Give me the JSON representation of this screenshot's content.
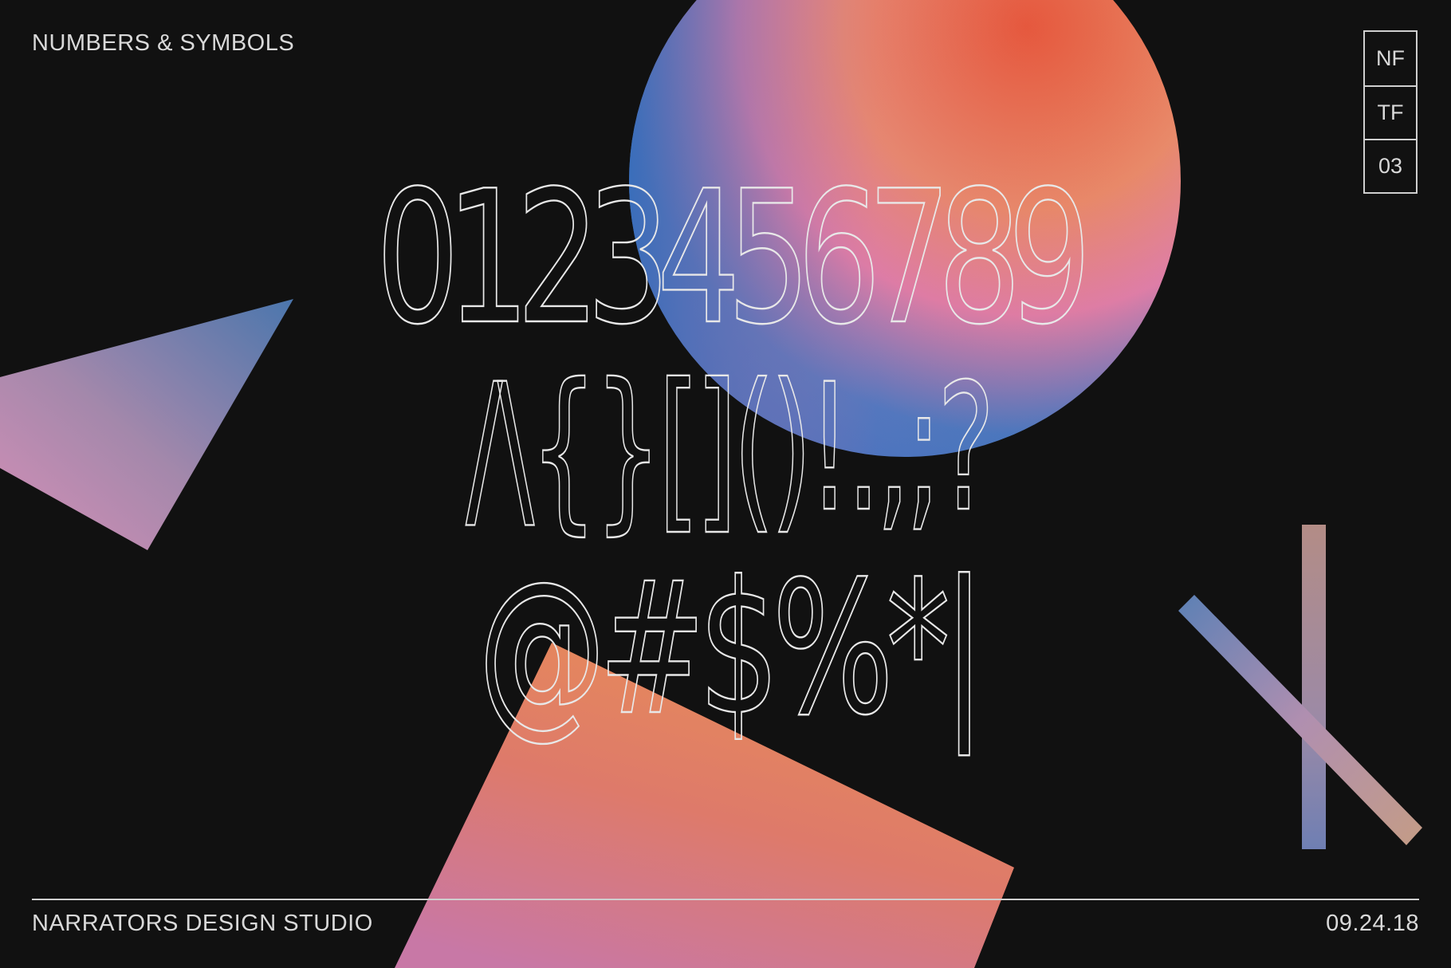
{
  "header": {
    "title": "NUMBERS & SYMBOLS"
  },
  "badge": {
    "cells": [
      "NF",
      "TF",
      "03"
    ]
  },
  "specimen": {
    "digits": "0123456789",
    "brackets": "/\\{}[]()!.,;?",
    "symbols": "@#$%*|"
  },
  "footer": {
    "studio": "NARRATORS DESIGN STUDIO",
    "date": "09.24.18"
  },
  "colors": {
    "background": "#111111",
    "text": "#d9d9d9",
    "orb_orange": "#e2623d",
    "orb_pink": "#e07ca0",
    "orb_blue": "#2f74c0",
    "triangle_blue": "#4f7ab0",
    "triangle_pink": "#c88bb3",
    "shard_orange": "#e38a55",
    "shard_pink": "#d57b9e"
  }
}
